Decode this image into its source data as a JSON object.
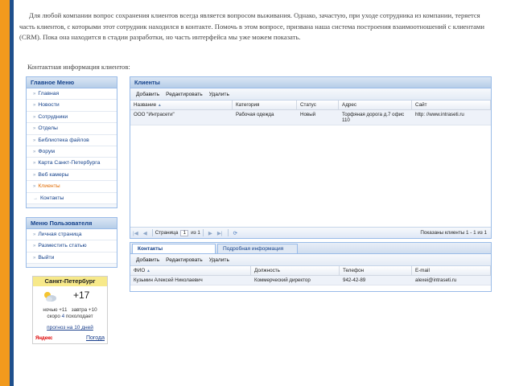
{
  "intro_text": "Для любой компании вопрос сохранения клиентов всегда является вопросом выживания. Однако, зачастую, при уходе сотрудника из компании, теряется часть клиентов, с которыми этот сотрудник находился в контакте. Помочь в этом вопросе, призвана наша система построения взаимоотношений с клиентами (CRM). Пока она находится в стадии разработки, но часть интерфейса мы уже можем показать.",
  "contacts_caption": "Контактная информация клиентов:",
  "main_menu": {
    "title": "Главное Меню",
    "items": [
      {
        "label": "Главная"
      },
      {
        "label": "Новости"
      },
      {
        "label": "Сотрудники"
      },
      {
        "label": "Отделы"
      },
      {
        "label": "Библиотека файлов"
      },
      {
        "label": "Форум"
      },
      {
        "label": "Карта Санкт-Петербурга"
      },
      {
        "label": "Веб камеры"
      },
      {
        "label": "Клиенты"
      },
      {
        "label": "Контакты"
      }
    ]
  },
  "user_menu": {
    "title": "Меню Пользователя",
    "items": [
      {
        "label": "Личная страница"
      },
      {
        "label": "Разместить статью"
      },
      {
        "label": "Выйти"
      }
    ]
  },
  "weather": {
    "city": "Санкт-Петербург",
    "temp": "+17",
    "night": "ночью +11",
    "tomorrow": "завтра +10",
    "forecast_prefix": "скоро",
    "forecast_value": "4",
    "forecast_suffix": "похолодает",
    "forecast_link": "прогноз на 10 дней",
    "yandex_logo": "Яндекс",
    "pogoda_link": "Погода"
  },
  "clients_panel": {
    "title": "Клиенты",
    "toolbar": {
      "add": "Добавить",
      "edit": "Редактировать",
      "delete": "Удалить"
    },
    "columns": [
      "Название",
      "Категория",
      "Статус",
      "Адрес",
      "Сайт"
    ],
    "sort_indicator": "▲",
    "rows": [
      {
        "name": "ООО \"Интрасети\"",
        "category": "Рабочая одежда",
        "status": "Новый",
        "address": "Торфяная дорога д.7 офис 110",
        "site": "http: //www.intraseti.ru"
      }
    ],
    "pager": {
      "page_label": "Страница",
      "page_value": "1",
      "of_label": "из 1",
      "info": "Показаны клиенты 1 - 1 из 1"
    }
  },
  "contacts_panel": {
    "tabs": [
      "Контакты",
      "Подробная информация"
    ],
    "toolbar": {
      "add": "Добавить",
      "edit": "Редактировать",
      "delete": "Удалить"
    },
    "columns": [
      "ФИО",
      "Должность",
      "Телефон",
      "E-mail"
    ],
    "sort_indicator": "▲",
    "rows": [
      {
        "fio": "Кузьмин Алексей Николаевич",
        "position": "Коммерческий директор",
        "phone": "942-42-89",
        "email": "alexei@intraseti.ru"
      }
    ]
  },
  "colors": {
    "stripe_orange": "#f29a1d",
    "stripe_blue": "#1e4f8c",
    "header_text": "#15428b",
    "active_menu": "#e06a00"
  }
}
